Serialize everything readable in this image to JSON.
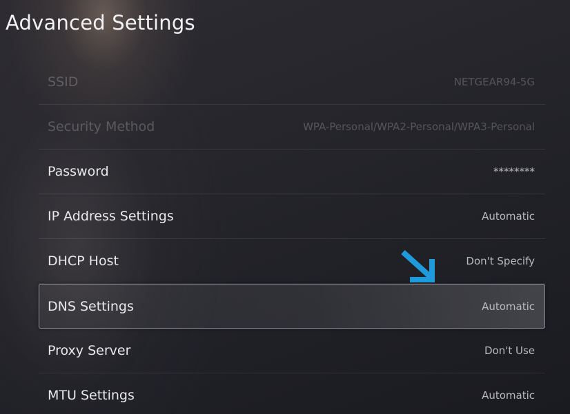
{
  "header": {
    "title": "Advanced Settings"
  },
  "settings": {
    "items": [
      {
        "label": "SSID",
        "value": "NETGEAR94-5G",
        "state": "disabled"
      },
      {
        "label": "Security Method",
        "value": "WPA-Personal/WPA2-Personal/WPA3-Personal",
        "state": "disabled"
      },
      {
        "label": "Password",
        "value": "********",
        "state": "enabled"
      },
      {
        "label": "IP Address Settings",
        "value": "Automatic",
        "state": "enabled"
      },
      {
        "label": "DHCP Host",
        "value": "Don't Specify",
        "state": "enabled"
      },
      {
        "label": "DNS Settings",
        "value": "Automatic",
        "state": "focused"
      },
      {
        "label": "Proxy Server",
        "value": "Don't Use",
        "state": "enabled"
      },
      {
        "label": "MTU Settings",
        "value": "Automatic",
        "state": "enabled"
      }
    ]
  },
  "annotation": {
    "icon": "arrow-down-right-icon",
    "color": "#1f9bdc"
  }
}
